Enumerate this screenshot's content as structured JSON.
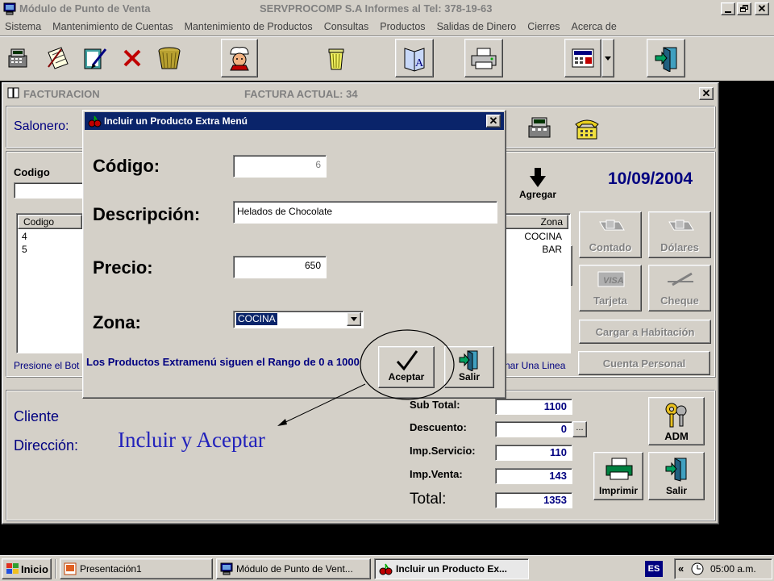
{
  "app": {
    "title": "Módulo de Punto de Venta",
    "company": "SERVPROCOMP S.A  Informes al Tel:  378-19-63"
  },
  "menu": [
    "Sistema",
    "Mantenimiento de Cuentas",
    "Mantenimiento de Productos",
    "Consultas",
    "Productos",
    "Salidas de Dinero",
    "Cierres",
    "Acerca de"
  ],
  "toolbar_icons": [
    "register-icon",
    "notepad-icon",
    "edit-pen-icon",
    "delete-x-icon",
    "basket-icon",
    "chef-icon",
    "trash-can-icon",
    "book-icon",
    "printer-icon",
    "calculator-screen-icon",
    "exit-door-icon"
  ],
  "facturacion": {
    "title": "FACTURACION",
    "current_invoice_label": "FACTURA ACTUAL:  34",
    "salonero_label": "Salonero:",
    "codigo_label": "Codigo",
    "agregar_label": "Agregar",
    "date": "10/09/2004",
    "list_header_codigo": "Codigo",
    "list_header_zona": "Zona",
    "list_codes": [
      "4",
      "5"
    ],
    "list_zonas": [
      "COCINA",
      "BAR"
    ],
    "hint_left": "Presione el Bot",
    "hint_right": "nar Una Linea",
    "pay_buttons": {
      "contado": "Contado",
      "dolares": "Dólares",
      "tarjeta": "Tarjeta",
      "cheque": "Cheque",
      "habitacion": "Cargar a Habitación",
      "personal": "Cuenta Personal"
    },
    "cliente_label": "Cliente",
    "direccion_label": "Dirección:",
    "totals": {
      "subtotal_label": "Sub Total:",
      "subtotal": "1100",
      "descuento_label": "Descuento:",
      "descuento": "0",
      "servicio_label": "Imp.Servicio:",
      "servicio": "110",
      "venta_label": "Imp.Venta:",
      "venta": "143",
      "total_label": "Total:",
      "total": "1353"
    },
    "adm_label": "ADM",
    "imprimir_label": "Imprimir",
    "salir_label": "Salir"
  },
  "dialog": {
    "title": "Incluir un Producto Extra Menú",
    "codigo_label": "Código:",
    "codigo_value": "6",
    "descripcion_label": "Descripción:",
    "descripcion_value": "Helados de Chocolate",
    "precio_label": "Precio:",
    "precio_value": "650",
    "zona_label": "Zona:",
    "zona_value": "COCINA",
    "note": "Los Productos Extramenú siguen el Rango de 0 a 1000",
    "aceptar_label": "Aceptar",
    "salir_label": "Salir"
  },
  "annotation": "Incluir y Aceptar",
  "taskbar": {
    "start_label": "Inicio",
    "tasks": [
      "Presentación1",
      "Módulo de Punto de Vent...",
      "Incluir un Producto Ex..."
    ],
    "lang": "ES",
    "time": "05:00 a.m."
  },
  "colors": {
    "title_active": "#0a246a",
    "title_inactive": "#808080",
    "face": "#d4d0c8",
    "value_blue": "#000080",
    "annotation": "#2222bb"
  }
}
